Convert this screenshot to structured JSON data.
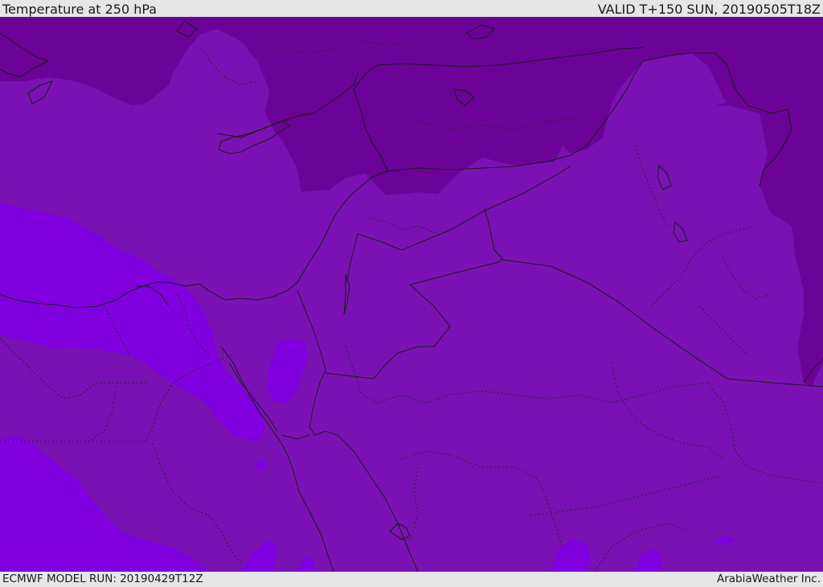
{
  "header": {
    "title": "Temperature at 250 hPa",
    "valid": "VALID T+150 SUN, 20190505T18Z"
  },
  "footer": {
    "model_run": "ECMWF MODEL RUN: 20190429T12Z",
    "credit": "ArabiaWeather Inc."
  },
  "map": {
    "variable": "temperature",
    "level": "250 hPa",
    "colors": {
      "cold_band": "#6b0399",
      "mid_band": "#7a12b3",
      "warm_band": "#8000e0",
      "borders": "#1a1a1a",
      "internal_borders": "#222222"
    }
  }
}
